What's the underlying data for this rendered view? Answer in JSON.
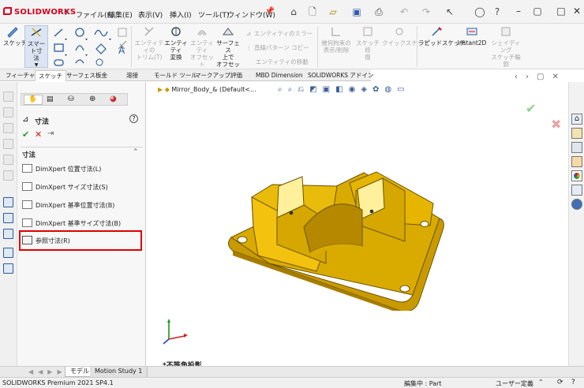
{
  "app": {
    "brand": "SOLIDWORKS"
  },
  "menu": [
    "ファイル(F)",
    "編集(E)",
    "表示(V)",
    "挿入(I)",
    "ツール(T)",
    "ウィンドウ(W)"
  ],
  "command_manager": {
    "sketch": "スケッチ",
    "smart_dim": "スマート寸\n法",
    "trim": "エンティティの\nトリム(T)",
    "convert": "エンティティ\n変換",
    "offset": "エンティティ\nオフセット",
    "surface_offset": "サーフェス\n上で\nオフセット",
    "mirror": "エンティティのミラー",
    "linear_pattern": "直線パターン コピー",
    "move": "エンティティの移動",
    "display_delete": "幾何拘束の\n表示/削除",
    "repair": "スケッチ修\n復",
    "quick_snap": "クイックスナップ",
    "rapid_sketch": "ラピッドスケッチ",
    "instant2d": "Instant2D",
    "shaded_sketch": "シェイディング\nスケッチ輪\n郭"
  },
  "tabs": [
    "フィーチャー",
    "スケッチ",
    "サーフェス",
    "板金",
    "溶接",
    "モールド ツール",
    "マークアップ",
    "評価",
    "MBD Dimension",
    "SOLIDWORKS アドイン"
  ],
  "active_tab": 1,
  "property_manager": {
    "title": "寸法",
    "section_title": "寸法",
    "items": [
      {
        "label": "DimXpert 位置寸法(L)"
      },
      {
        "label": "DimXpert サイズ寸法(S)"
      },
      {
        "label": "DimXpert 基準位置寸法(B)"
      },
      {
        "label": "DimXpert 基準サイズ寸法(B)"
      },
      {
        "label": "参照寸法(R)"
      }
    ],
    "highlighted_index": 4
  },
  "viewport": {
    "tree_label": "Mirror_Body_& (Default<...",
    "view_label": "*不等角投影"
  },
  "bottom_tabs": [
    "モデル",
    "Motion Study 1"
  ],
  "status": {
    "product": "SOLIDWORKS Premium 2021 SP4.1",
    "mode": "編集中 : Part",
    "units": "ユーザー定義"
  },
  "colors": {
    "part": "#e3b400",
    "highlight": "#e00000",
    "brand": "#d7001d"
  }
}
